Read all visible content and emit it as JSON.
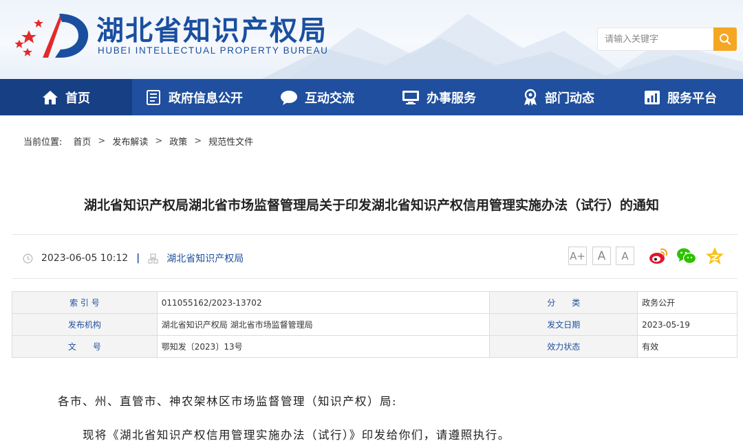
{
  "header": {
    "title": "湖北省知识产权局",
    "subtitle": "HUBEI INTELLECTUAL PROPERTY BUREAU",
    "search_placeholder": "请输入关键字",
    "brand_color": "#1f4f9e",
    "accent_color": "#f5a623"
  },
  "nav": {
    "items": [
      {
        "label": "首页",
        "icon": "home-icon"
      },
      {
        "label": "政府信息公开",
        "icon": "document-list-icon"
      },
      {
        "label": "互动交流",
        "icon": "chat-bubble-icon"
      },
      {
        "label": "办事服务",
        "icon": "monitor-icon"
      },
      {
        "label": "部门动态",
        "icon": "award-person-icon"
      },
      {
        "label": "服务平台",
        "icon": "bar-chart-icon"
      }
    ],
    "active_index": 0
  },
  "breadcrumb": {
    "label": "当前位置:",
    "items": [
      "首页",
      "发布解读",
      "政策",
      "规范性文件"
    ],
    "separator": ">"
  },
  "article": {
    "title": "湖北省知识产权局湖北省市场监督管理局关于印发湖北省知识产权信用管理实施办法（试行）的通知",
    "datetime": "2023-06-05 10:12",
    "meta_separator": "|",
    "publisher": "湖北省知识产权局",
    "font_controls": [
      "A+",
      "A",
      "A"
    ],
    "share": [
      "weibo-icon",
      "wechat-icon",
      "qzone-icon"
    ]
  },
  "info_table": {
    "rows": [
      [
        {
          "key": "索 引 号",
          "value": "011055162/2023-13702"
        },
        {
          "key": "分　　类",
          "value": "政务公开"
        }
      ],
      [
        {
          "key": "发布机构",
          "value": "湖北省知识产权局 湖北省市场监督管理局"
        },
        {
          "key": "发文日期",
          "value": "2023-05-19"
        }
      ],
      [
        {
          "key": "文　　号",
          "value": "鄂知发〔2023〕13号"
        },
        {
          "key": "效力状态",
          "value": "有效"
        }
      ]
    ]
  },
  "body": {
    "salutation": "各市、州、直管市、神农架林区市场监督管理（知识产权）局:",
    "paragraph1": "现将《湖北省知识产权信用管理实施办法（试行）》印发给你们，请遵照执行。"
  }
}
